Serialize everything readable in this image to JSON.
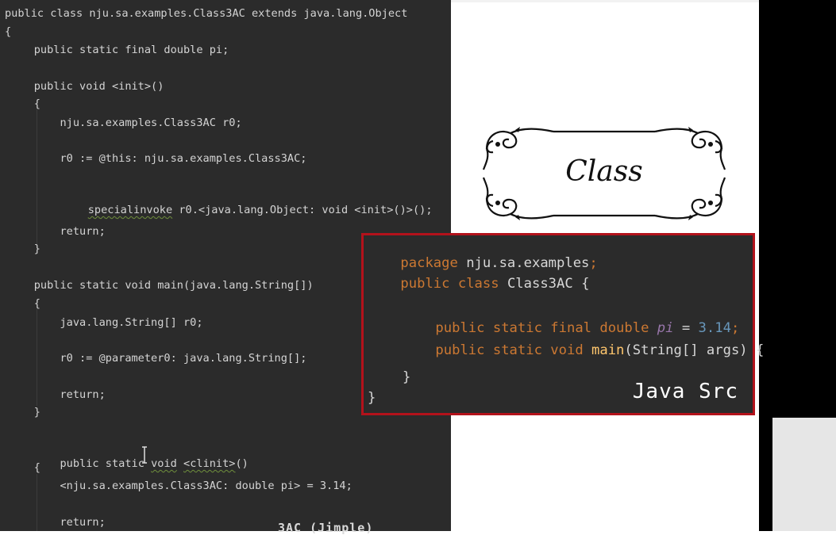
{
  "jimple": {
    "lines": [
      "public class nju.sa.examples.Class3AC extends java.lang.Object",
      "{",
      "    public static final double pi;",
      "    public void <init>()",
      "    {",
      "        nju.sa.examples.Class3AC r0;",
      "        r0 := @this: nju.sa.examples.Class3AC;",
      "specialinvoke",
      " r0.<java.lang.Object: void <init>()>();",
      "        return;",
      "    }",
      "    public static void main(java.lang.String[])",
      "    {",
      "        java.lang.String[] r0;",
      "        r0 := @parameter0: java.lang.String[];",
      "        return;",
      "    }",
      "    public static ",
      "void",
      " ",
      "<clinit>",
      "()",
      "    {",
      "        <nju.sa.examples.Class3AC: double pi> = 3.14;",
      "        return;"
    ],
    "footer": "3AC (Jimple)"
  },
  "class_card": {
    "title": "Class"
  },
  "java_src": {
    "package_kw": "package",
    "package_name": " nju.sa.examples",
    "semicolon": ";",
    "class_kw": "public class",
    "class_name": " Class3AC {",
    "field_kw": "public static final double ",
    "field_name": "pi",
    "field_eq": " = ",
    "field_val": "3.14",
    "field_semi": ";",
    "main_kw": "public static void ",
    "main_name": "main",
    "main_rest": "(String[] args) {",
    "inner_close": "}",
    "outer_close": "}",
    "label": "Java Src"
  },
  "colors": {
    "editor_bg": "#2b2b2b",
    "keyword": "#cc7832",
    "number": "#6897bb",
    "highlight_border": "#b3121b"
  }
}
